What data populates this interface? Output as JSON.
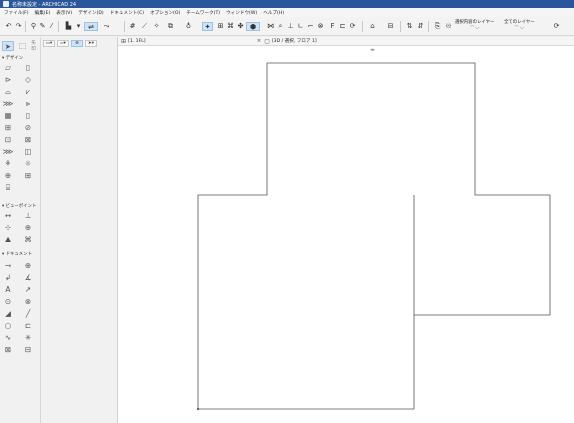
{
  "window": {
    "title": "名称未設定 - ARCHICAD 24"
  },
  "menu": [
    "ファイル(F)",
    "編集(E)",
    "表示(V)",
    "デザイン(D)",
    "ドキュメント(C)",
    "オプション(O)",
    "チームワーク(T)",
    "ウィンドウ(W)",
    "ヘルプ(H)"
  ],
  "toolbar": {
    "layer_combo_label": "選択内容のレイヤー",
    "layer_all_label": "全てのレイヤー"
  },
  "toolbox": {
    "selection_label": "矢印",
    "sections": {
      "design": "デザイン",
      "viewpoint": "ビューポイント",
      "document": "ドキュメント"
    }
  },
  "info_box": {
    "mode_label": "矢印"
  },
  "tabs": [
    {
      "label": "[1. 1FL]",
      "icon": "floor-plan-icon"
    },
    {
      "label": "[3D / 選択, フロア 1]",
      "icon": "3d-window-icon"
    }
  ],
  "colors": {
    "titlebar": "#2b579a",
    "selection_highlight": "#cfe3f7",
    "drawing_line": "#555555"
  }
}
